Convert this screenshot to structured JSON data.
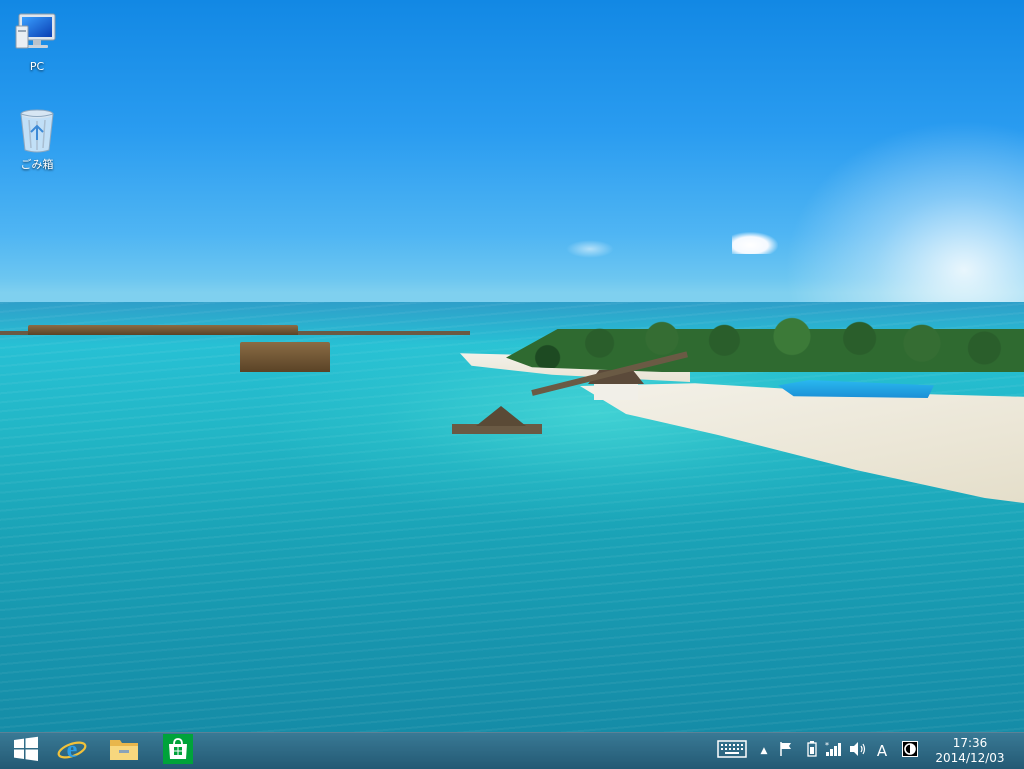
{
  "desktop": {
    "icons": [
      {
        "name": "pc",
        "label": "PC"
      },
      {
        "name": "recycle-bin",
        "label": "ごみ箱"
      }
    ]
  },
  "taskbar": {
    "pinned": [
      {
        "name": "start-button",
        "icon": "windows-logo-icon"
      },
      {
        "name": "internet-explorer",
        "icon": "internet-explorer-icon"
      },
      {
        "name": "file-explorer",
        "icon": "folder-icon"
      },
      {
        "name": "store",
        "icon": "store-bag-icon"
      }
    ],
    "tray": {
      "keyboard": "keyboard-icon",
      "show_hidden": "▲",
      "action_center": "flag-icon",
      "battery": "battery-icon",
      "network": "network-icon",
      "volume": "speaker-icon",
      "ime_mode": "A",
      "ime": "ime-icon"
    },
    "clock": {
      "time": "17:36",
      "date": "2014/12/03"
    }
  },
  "colors": {
    "taskbar": "#1d5b78",
    "sky_top": "#1288e4",
    "sea": "#1aa2b6",
    "store_green": "#00a33a"
  }
}
